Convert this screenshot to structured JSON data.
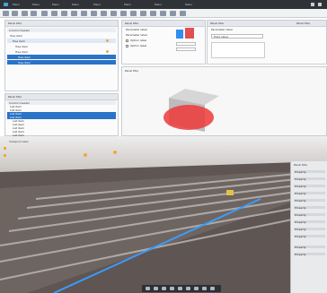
{
  "window": {
    "menu_items": [
      "Menu",
      "Menu",
      "Menu",
      "Menu",
      "Menu",
      "Menu",
      "Menu",
      "Menu"
    ],
    "search_placeholder": "Search"
  },
  "scene_tree": {
    "title": "Panel title",
    "header_label": "Column header",
    "items": [
      {
        "label": "Tree item",
        "level": 0,
        "state": "normal"
      },
      {
        "label": "Tree item",
        "level": 1,
        "state": "light"
      },
      {
        "label": "Tree item",
        "level": 2,
        "state": "normal"
      },
      {
        "label": "Tree item",
        "level": 2,
        "state": "normal"
      },
      {
        "label": "Tree item",
        "level": 3,
        "state": "selected"
      },
      {
        "label": "Tree item",
        "level": 3,
        "state": "selected"
      }
    ]
  },
  "parameters": {
    "title": "Panel title",
    "rows": [
      "Parameter label",
      "Parameter label",
      "Option label",
      "Option label"
    ],
    "right_title": "Panel title",
    "right_rows": [
      "Parameter label",
      "Field value"
    ],
    "right_header": "Panel title"
  },
  "preview": {
    "title": "Panel title"
  },
  "results": {
    "title": "Panel title",
    "header_label": "Column header",
    "items": [
      {
        "label": "List item",
        "state": "normal"
      },
      {
        "label": "List item",
        "state": "normal"
      },
      {
        "label": "List item",
        "state": "selected"
      },
      {
        "label": "List item",
        "state": "selected"
      },
      {
        "label": "List item",
        "state": "normal"
      },
      {
        "label": "List item",
        "state": "normal"
      },
      {
        "label": "List item",
        "state": "normal"
      },
      {
        "label": "List item",
        "state": "normal"
      },
      {
        "label": "List item",
        "state": "normal"
      },
      {
        "label": "List item",
        "state": "normal"
      }
    ]
  },
  "viewport": {
    "label": "Viewport label"
  },
  "properties": {
    "title": "Panel title",
    "rows": [
      "Property",
      "Property",
      "Property",
      "Property",
      "Property",
      "Property",
      "Property",
      "Property",
      "Property",
      "Property",
      "Property",
      "Property"
    ]
  },
  "colors": {
    "accent": "#2b73c7",
    "warning": "#f0a93a",
    "box_blue": "#2f8ff0",
    "box_red": "#e05050",
    "highlight": "#3a9cff"
  }
}
